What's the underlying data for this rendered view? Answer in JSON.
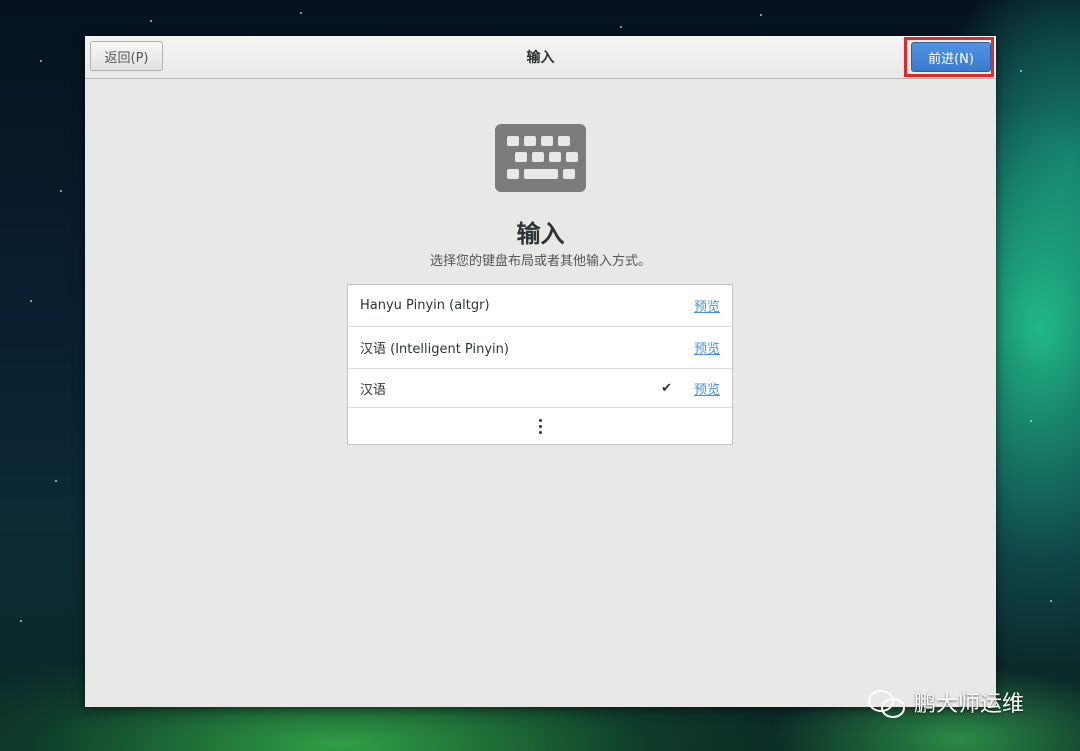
{
  "header": {
    "back_label": "返回(P)",
    "title": "输入",
    "next_label": "前进(N)"
  },
  "main": {
    "icon": "keyboard-icon",
    "title": "输入",
    "subtitle": "选择您的键盘布局或者其他输入方式。"
  },
  "layouts": [
    {
      "label": "Hanyu Pinyin (altgr)",
      "selected": false,
      "preview_label": "预览"
    },
    {
      "label": "汉语 (Intelligent Pinyin)",
      "selected": false,
      "preview_label": "预览"
    },
    {
      "label": "汉语",
      "selected": true,
      "check": "✔",
      "preview_label": "预览"
    }
  ],
  "more_icon": "view-more-icon",
  "watermark": {
    "text": "鹏大师运维",
    "icon": "wechat-icon"
  },
  "colors": {
    "highlight_border": "#e82626",
    "next_button": "#3a7bd0",
    "link": "#4a90d9"
  }
}
